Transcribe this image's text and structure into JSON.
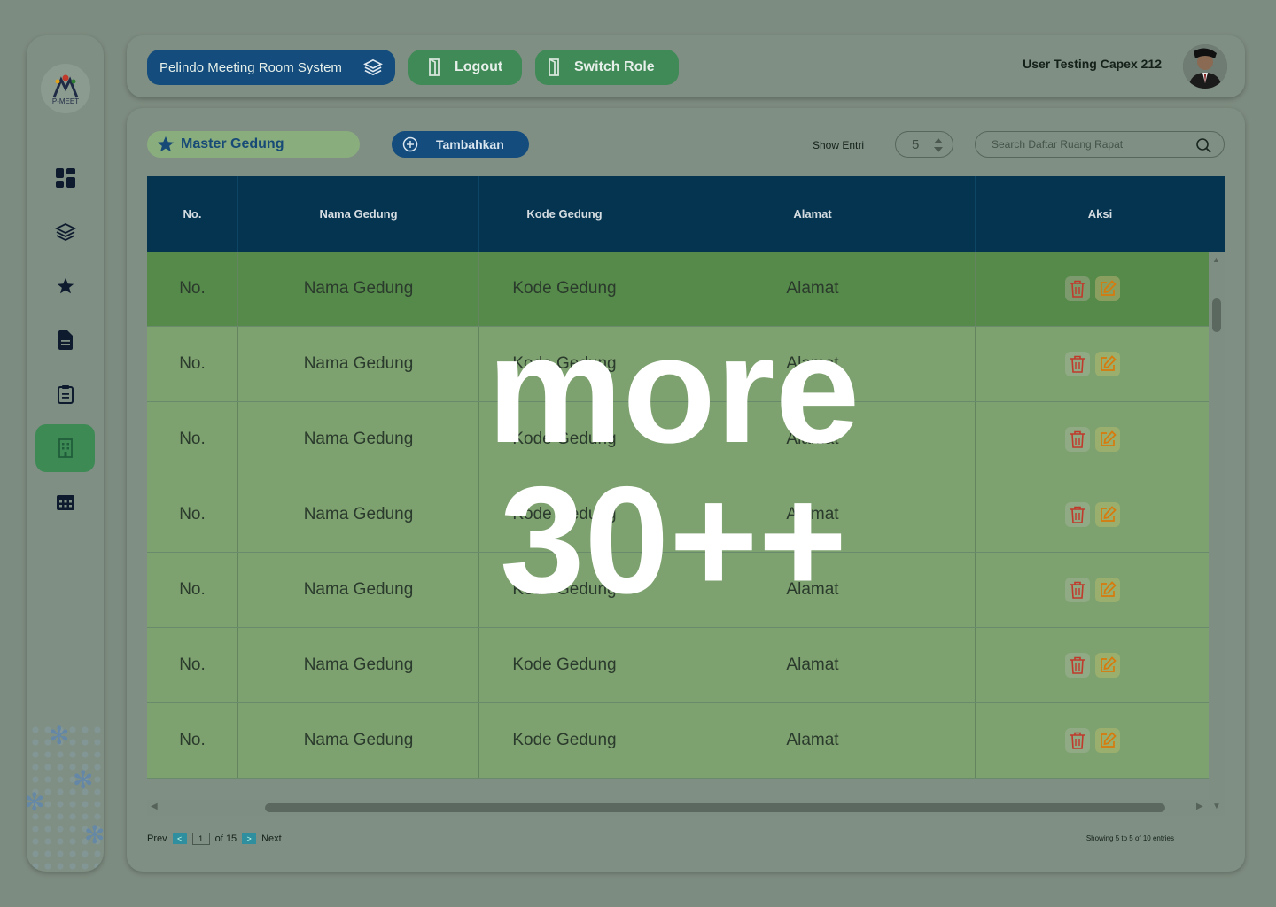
{
  "app": {
    "logo_text": "P-MEET",
    "system_name": "Pelindo Meeting Room System",
    "logout_label": "Logout",
    "switch_role_label": "Switch Role",
    "user_name": "User Testing Capex 212"
  },
  "sidebar": {
    "items": [
      {
        "icon": "dashboard-icon",
        "active": false
      },
      {
        "icon": "layers-icon",
        "active": false
      },
      {
        "icon": "star-icon",
        "active": false
      },
      {
        "icon": "document-icon",
        "active": false
      },
      {
        "icon": "clipboard-icon",
        "active": false
      },
      {
        "icon": "building-icon",
        "active": true
      },
      {
        "icon": "calendar-icon",
        "active": false
      }
    ]
  },
  "page": {
    "section_title": "Master Gedung",
    "add_label": "Tambahkan",
    "show_entri_label": "Show Entri",
    "show_entri_value": "5",
    "search_placeholder": "Search Daftar Ruang Rapat"
  },
  "table": {
    "headers": [
      "No.",
      "Nama Gedung",
      "Kode Gedung",
      "Alamat",
      "Aksi"
    ],
    "rows": [
      [
        "No.",
        "Nama Gedung",
        "Kode Gedung",
        "Alamat"
      ],
      [
        "No.",
        "Nama Gedung",
        "Kode Gedung",
        "Alamat"
      ],
      [
        "No.",
        "Nama Gedung",
        "Kode Gedung",
        "Alamat"
      ],
      [
        "No.",
        "Nama Gedung",
        "Kode Gedung",
        "Alamat"
      ],
      [
        "No.",
        "Nama Gedung",
        "Kode Gedung",
        "Alamat"
      ],
      [
        "No.",
        "Nama Gedung",
        "Kode Gedung",
        "Alamat"
      ],
      [
        "No.",
        "Nama Gedung",
        "Kode Gedung",
        "Alamat"
      ]
    ]
  },
  "pagination": {
    "prev_label": "Prev",
    "prev_symbol": "<",
    "current_page": "1",
    "of_label": "of 15",
    "next_symbol": ">",
    "next_label": "Next",
    "showing_text": "Showing 5 to 5 of 10 entries"
  },
  "overlay": {
    "line1": "more",
    "line2": "30++"
  },
  "colors": {
    "header_blue": "#134c7d",
    "table_header": "#04344f",
    "active_green": "#3d8a55",
    "row_green": "#7ea26f",
    "row_highlight": "#568a4a"
  }
}
